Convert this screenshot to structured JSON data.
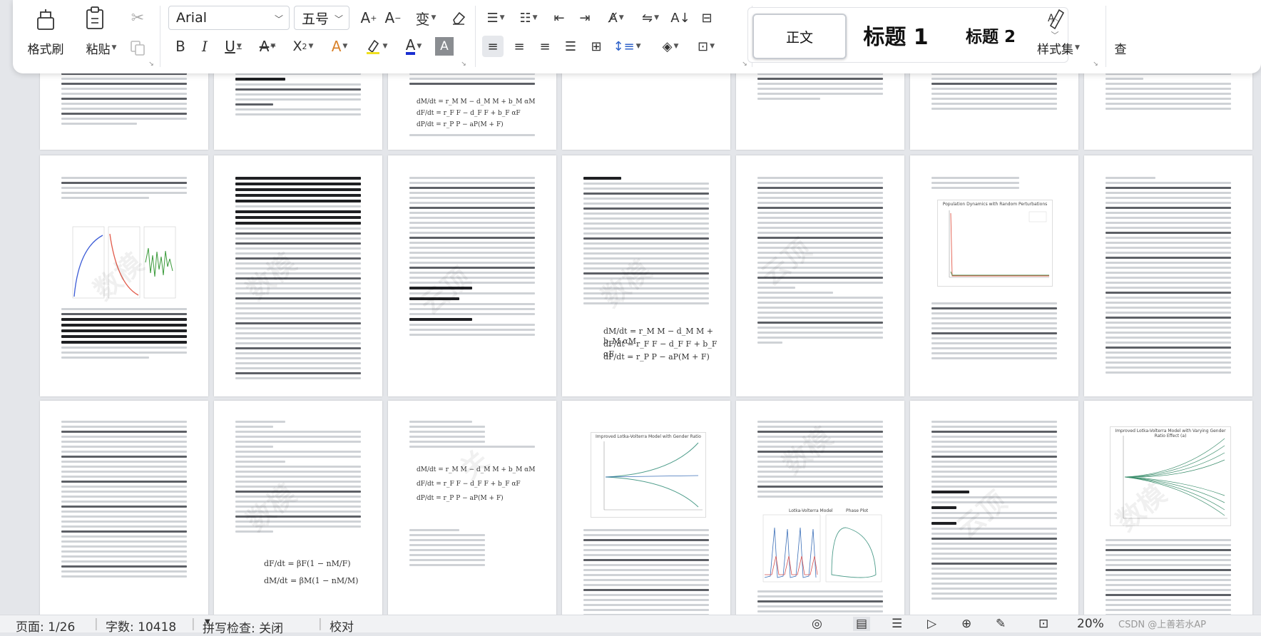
{
  "ribbon": {
    "format_painter_label": "格式刷",
    "paste_label": "粘贴",
    "font_name": "Arial",
    "font_size": "五号",
    "styles": {
      "normal": "正文",
      "heading1": "标题 1",
      "heading2": "标题 2"
    },
    "style_set_label": "样式集",
    "find_label": "查"
  },
  "pages": {
    "p2_chart1_title": "Population Dynamics with Random Perturbations",
    "p3_chart1_title": "Improved Lotka-Volterra Model with Gender Ratio",
    "p3_chart2_title": "Lotka-Volterra Model",
    "p3_chart3_title": "Phase Plot",
    "p3_chart4_title": "Improved Lotka-Volterra Model with Varying Gender Ratio Effect (a)",
    "eq_m": "dM/dt = r_M M − d_M M + b_M αM",
    "eq_f": "dF/dt = r_F F − d_F F + b_F αF",
    "eq_p": "dP/dt = r_P P − aP(M + F)"
  },
  "status": {
    "page": "页面: 1/26",
    "words": "字数: 10418",
    "spell": "拼写检查: 关闭",
    "proof": "校对",
    "zoom": "20%",
    "watermark": "CSDN @上善若水AP"
  }
}
